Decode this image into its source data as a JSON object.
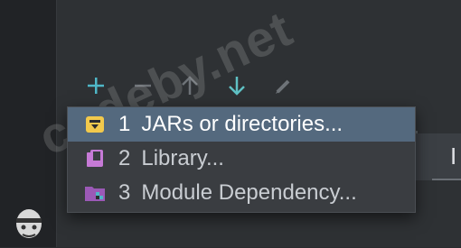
{
  "toolbar": {
    "buttons": [
      {
        "name": "add",
        "icon": "plus-icon",
        "color": "#4fb7c7"
      },
      {
        "name": "remove",
        "icon": "minus-icon",
        "color": "#6e7378"
      },
      {
        "name": "move-up",
        "icon": "arrow-up-icon",
        "color": "#6e7378"
      },
      {
        "name": "move-down",
        "icon": "arrow-down-icon",
        "color": "#5fc1c4"
      },
      {
        "name": "edit",
        "icon": "pencil-icon",
        "color": "#6e7378"
      }
    ]
  },
  "header_partial_text": "I",
  "popup": {
    "items": [
      {
        "number": "1",
        "label": "JARs or directories...",
        "icon": "jar-folder-icon",
        "selected": true
      },
      {
        "number": "2",
        "label": "Library...",
        "icon": "library-icon",
        "selected": false
      },
      {
        "number": "3",
        "label": "Module Dependency...",
        "icon": "module-icon",
        "selected": false
      }
    ]
  },
  "watermark": {
    "text": "codeby.net"
  },
  "colors": {
    "accent_selected": "#54697e",
    "popup_bg": "#3a3d41",
    "jar_icon": "#f2c94c",
    "library_icon": "#c67ad6",
    "module_icon": "#9b59b6"
  }
}
